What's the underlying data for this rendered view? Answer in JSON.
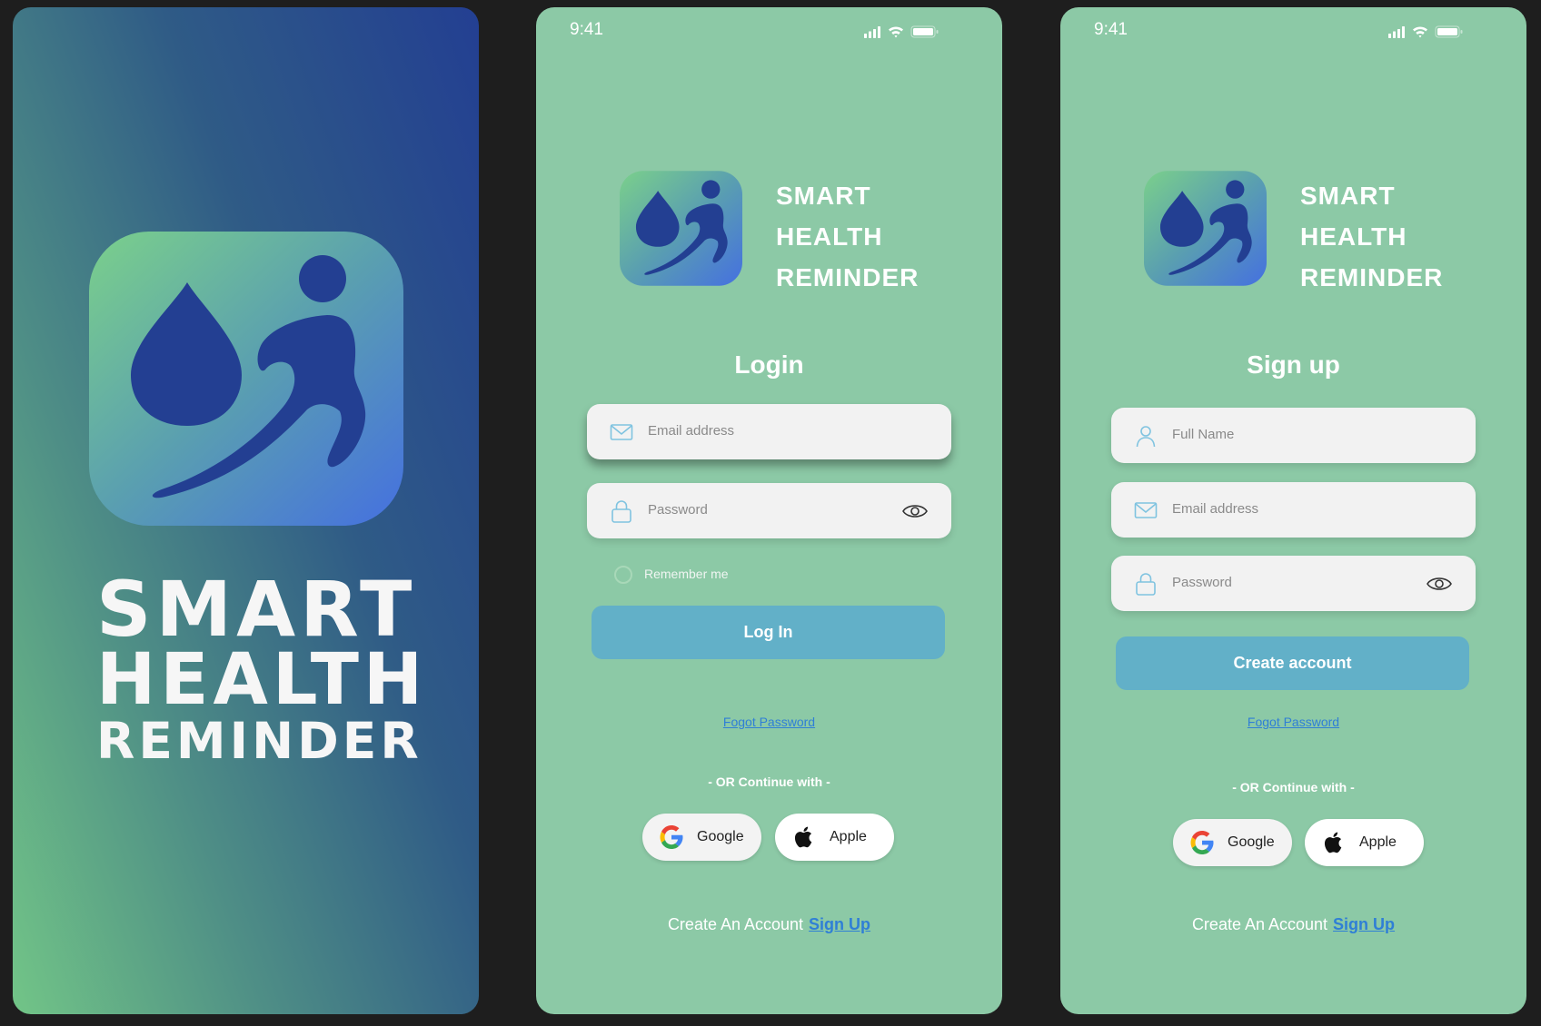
{
  "splash": {
    "title_line1": "SMART",
    "title_line2": "HEALTH",
    "title_line3": "REMINDER",
    "icon": "water-drop-runner-icon"
  },
  "status_bar": {
    "time": "9:41",
    "icons": [
      "signal-icon",
      "wifi-icon",
      "battery-icon"
    ]
  },
  "brand": {
    "line1": "SMART",
    "line2": "HEALTH",
    "line3": "REMINDER"
  },
  "login": {
    "heading": "Login",
    "email_placeholder": "Email address",
    "password_placeholder": "Password",
    "remember_label": "Remember me",
    "login_button": "Log In",
    "forgot_link": "Fogot Password",
    "or_text": "- OR Continue with -",
    "google_label": "Google",
    "apple_label": "Apple",
    "footer_text": "Create An Account",
    "footer_link": "Sign Up"
  },
  "signup": {
    "heading": "Sign up",
    "name_placeholder": "Full Name",
    "email_placeholder": "Email address",
    "password_placeholder": "Password",
    "create_button": "Create account",
    "forgot_link": "Fogot Password",
    "or_text": "- OR Continue with -",
    "google_label": "Google",
    "apple_label": "Apple",
    "footer_text": "Create An Account",
    "footer_link": "Sign Up"
  },
  "colors": {
    "screen_bg": "#8cc9a6",
    "primary_button": "#62b0c8",
    "link": "#2f7fd6",
    "logo_blue": "#233f92"
  }
}
